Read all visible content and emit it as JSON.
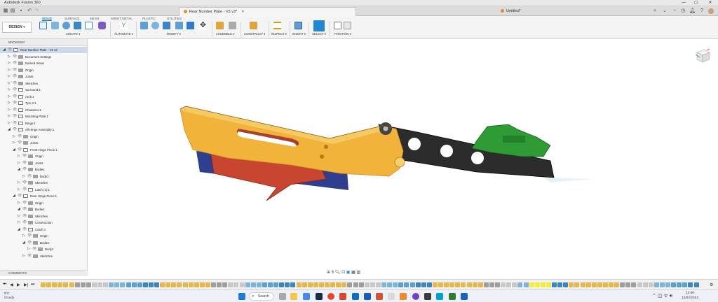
{
  "window": {
    "title": "Autodesk Fusion 360",
    "controls": [
      "—",
      "▢",
      "✕"
    ]
  },
  "tabs": {
    "active": {
      "label": "Rear Number Plate - V3 v3*"
    },
    "inactive": {
      "label": "Untitled*"
    }
  },
  "ribbon": {
    "workspace": "DESIGN ▾",
    "tabs": [
      "SOLID",
      "SURFACE",
      "MESH",
      "SHEET METAL",
      "PLASTIC",
      "UTILITIES"
    ],
    "active_tab": "SOLID",
    "groups": [
      "CREATE ▾",
      "AUTOMATE ▾",
      "MODIFY ▾",
      "ASSEMBLE ▾",
      "CONSTRUCT ▾",
      "INSPECT ▾",
      "INSERT ▾",
      "SELECT ▾",
      "POSITION ▾"
    ],
    "tool_colors": {
      "sketch": "#2b7bd1",
      "solid": "#3a86c8",
      "automate": "#4e7fbf",
      "construct": "#e0a43a",
      "inspect": "#d4a012",
      "select": "#1e88d8"
    }
  },
  "browser": {
    "header": "BROWSER",
    "root": "Rear Number Plate - V3 v3",
    "items": [
      {
        "label": "Document Settings",
        "depth": 1
      },
      {
        "label": "Named Views",
        "depth": 1
      },
      {
        "label": "Origin",
        "depth": 1
      },
      {
        "label": "Joints",
        "depth": 1
      },
      {
        "label": "Sketches",
        "depth": 1
      },
      {
        "label": "Surround:1",
        "depth": 1
      },
      {
        "label": "Arch:1",
        "depth": 1
      },
      {
        "label": "Tyre 1:1",
        "depth": 1
      },
      {
        "label": "Chadamo:1",
        "depth": 1
      },
      {
        "label": "Mounting Plate:1",
        "depth": 1
      },
      {
        "label": "Rings:1",
        "depth": 1
      },
      {
        "label": "All Hinge Assembly:1",
        "depth": 1
      },
      {
        "label": "Origin",
        "depth": 2
      },
      {
        "label": "Joints",
        "depth": 2
      },
      {
        "label": "Front Hinge Piece:1",
        "depth": 2
      },
      {
        "label": "Origin",
        "depth": 3
      },
      {
        "label": "Joints",
        "depth": 3
      },
      {
        "label": "Bodies",
        "depth": 3
      },
      {
        "label": "Body1",
        "depth": 4
      },
      {
        "label": "Sketches",
        "depth": 3
      },
      {
        "label": "Latch (1):1",
        "depth": 3
      },
      {
        "label": "Rear Hinge Piece:1",
        "depth": 2
      },
      {
        "label": "Origin",
        "depth": 3
      },
      {
        "label": "Bodies",
        "depth": 3
      },
      {
        "label": "Sketches",
        "depth": 3
      },
      {
        "label": "Construction",
        "depth": 3
      },
      {
        "label": "Catch:1",
        "depth": 3
      },
      {
        "label": "Origin",
        "depth": 4
      },
      {
        "label": "Bodies",
        "depth": 4
      },
      {
        "label": "Body1",
        "depth": 5
      },
      {
        "label": "Sketches",
        "depth": 4
      }
    ]
  },
  "comments": {
    "label": "COMMENTS"
  },
  "navbar": {
    "icons": [
      "orbit-icon",
      "pan-icon",
      "zoom-icon",
      "fit-icon",
      "display-icon",
      "grid-icon",
      "viewports-icon"
    ]
  },
  "viewcube": {
    "label": "FRONT"
  },
  "model_colors": {
    "hinge_front": "#f1b33a",
    "hinge_dark": "#c98a1a",
    "plate_back": "#2c2c2c",
    "catch": "#2e9b35",
    "latch_red": "#c8452f",
    "latch_blue": "#2f3f8f"
  },
  "timeline": {
    "controls": [
      "⏮",
      "◀",
      "▶",
      "▶|",
      "⏭"
    ]
  },
  "taskbar": {
    "weather_temp": "9°C",
    "weather_desc": "Cloudy",
    "search": "Search",
    "time": "13:50",
    "date": "12/02/2023"
  }
}
